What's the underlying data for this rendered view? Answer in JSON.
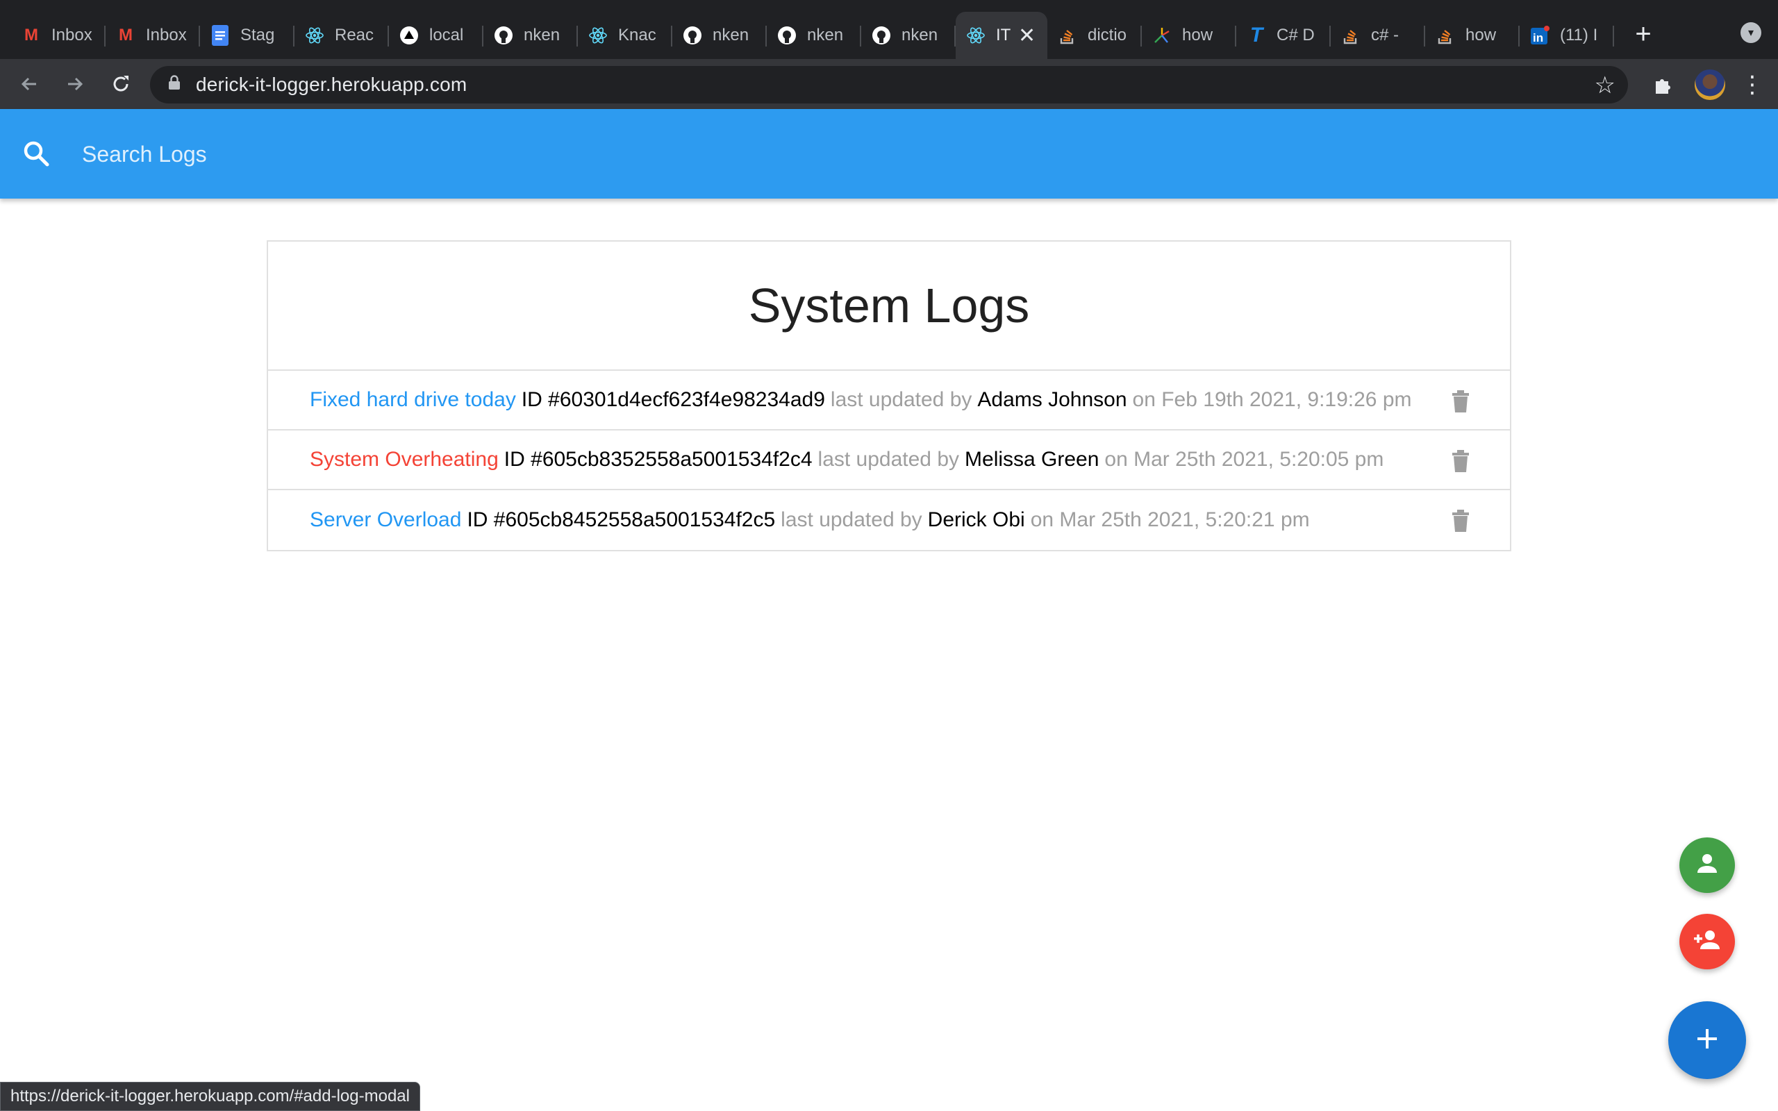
{
  "browser": {
    "tabs": [
      {
        "icon": "gmail-icon",
        "label": "Inbox",
        "color": "#ea4335"
      },
      {
        "icon": "gmail-icon",
        "label": "Inbox",
        "color": "#ea4335"
      },
      {
        "icon": "docs-icon",
        "label": "Stag",
        "color": "#4285f4"
      },
      {
        "icon": "react-icon",
        "label": "Reac",
        "color": "#61dafb"
      },
      {
        "icon": "vercel-icon",
        "label": "local",
        "color": "#ffffff"
      },
      {
        "icon": "github-icon",
        "label": "nken",
        "color": "#ffffff"
      },
      {
        "icon": "react-icon",
        "label": "Knac",
        "color": "#61dafb"
      },
      {
        "icon": "github-icon",
        "label": "nken",
        "color": "#ffffff"
      },
      {
        "icon": "github-icon",
        "label": "nken",
        "color": "#ffffff"
      },
      {
        "icon": "github-icon",
        "label": "nken",
        "color": "#ffffff"
      },
      {
        "icon": "react-icon",
        "label": "IT",
        "color": "#61dafb",
        "active": true
      },
      {
        "icon": "stackoverflow-icon",
        "label": "dictio",
        "color": "#f48024"
      },
      {
        "icon": "sparkle-icon",
        "label": "how",
        "color": "#34a853"
      },
      {
        "icon": "tutorialsteacher-icon",
        "label": "C# D",
        "color": "#1e88e5"
      },
      {
        "icon": "stackoverflow-icon",
        "label": "c# -",
        "color": "#f48024"
      },
      {
        "icon": "stackoverflow-icon",
        "label": "how",
        "color": "#f48024"
      },
      {
        "icon": "linkedin-icon",
        "label": "(11) I",
        "color": "#0a66c2"
      }
    ],
    "url": "derick-it-logger.herokuapp.com",
    "status_url": "https://derick-it-logger.herokuapp.com/#add-log-modal"
  },
  "search": {
    "placeholder": "Search Logs",
    "value": ""
  },
  "logs": {
    "title": "System Logs",
    "items": [
      {
        "message": "Fixed hard drive today",
        "attention": false,
        "id_label": "ID #60301d4ecf623f4e98234ad9",
        "updated_by_label": "last updated by",
        "tech": "Adams Johnson",
        "date": "on Feb 19th 2021, 9:19:26 pm"
      },
      {
        "message": "System Overheating",
        "attention": true,
        "id_label": "ID #605cb8352558a5001534f2c4",
        "updated_by_label": "last updated by",
        "tech": "Melissa Green",
        "date": "on Mar 25th 2021, 5:20:05 pm"
      },
      {
        "message": "Server Overload",
        "attention": false,
        "id_label": "ID #605cb8452558a5001534f2c5",
        "updated_by_label": "last updated by",
        "tech": "Derick Obi",
        "date": "on Mar 25th 2021, 5:20:21 pm"
      }
    ]
  },
  "colors": {
    "header_blue": "#2d9bf0",
    "link_blue": "#2196f3",
    "attention_red": "#f44336",
    "fab_green": "#43a047",
    "fab_red": "#f44336",
    "fab_blue": "#1976d2"
  },
  "fabs": [
    {
      "icon": "person-icon"
    },
    {
      "icon": "person-add-icon"
    },
    {
      "icon": "add-icon"
    }
  ]
}
